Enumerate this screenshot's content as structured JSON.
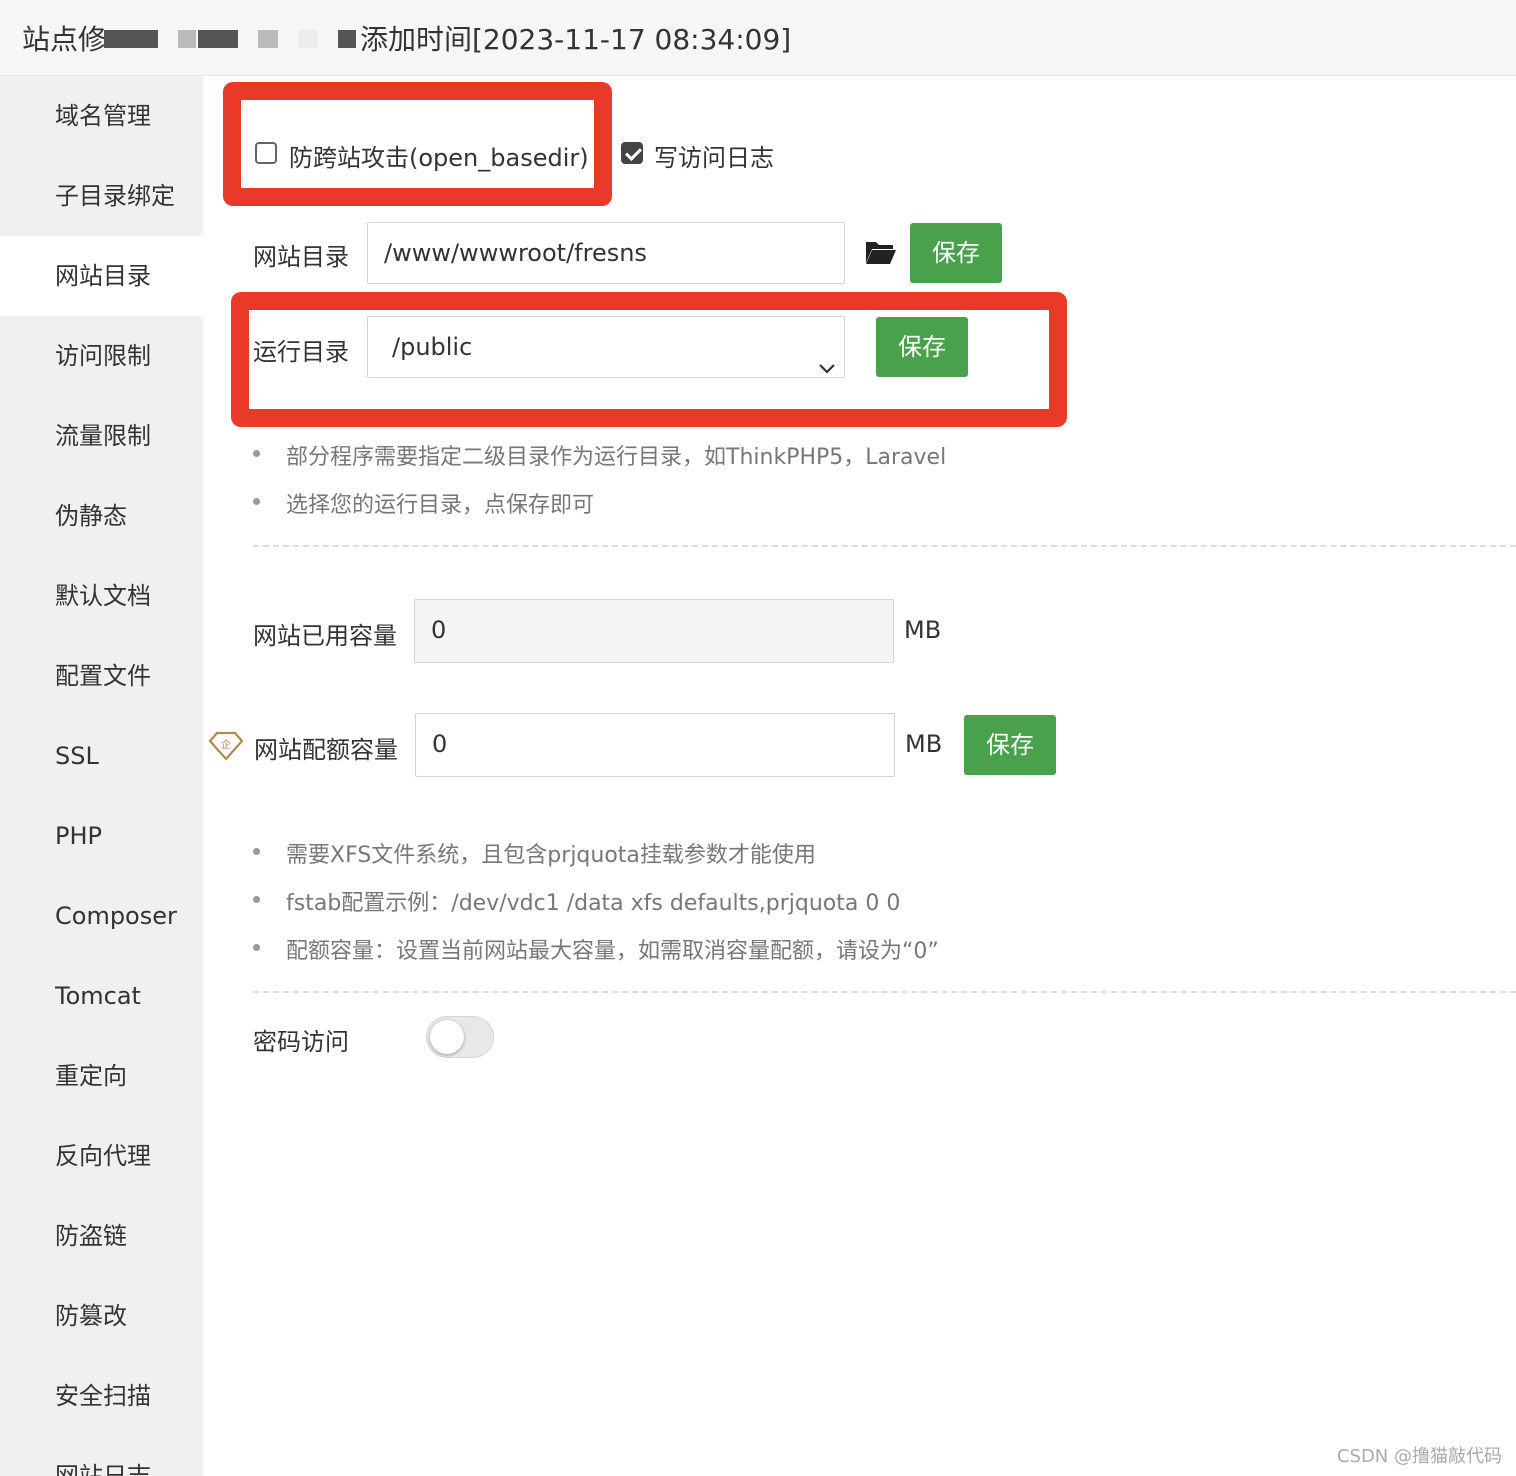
{
  "header": {
    "title_prefix": "站点修",
    "title_suffix": "添加时间[2023-11-17 08:34:09]"
  },
  "sidebar": {
    "items": [
      {
        "label": "域名管理"
      },
      {
        "label": "子目录绑定"
      },
      {
        "label": "网站目录",
        "active": true
      },
      {
        "label": "访问限制"
      },
      {
        "label": "流量限制"
      },
      {
        "label": "伪静态"
      },
      {
        "label": "默认文档"
      },
      {
        "label": "配置文件"
      },
      {
        "label": "SSL"
      },
      {
        "label": "PHP"
      },
      {
        "label": "Composer"
      },
      {
        "label": "Tomcat"
      },
      {
        "label": "重定向"
      },
      {
        "label": "反向代理"
      },
      {
        "label": "防盗链"
      },
      {
        "label": "防篡改"
      },
      {
        "label": "安全扫描"
      },
      {
        "label": "网站日志"
      }
    ]
  },
  "options": {
    "anti_xss_label": "防跨站攻击(open_basedir)",
    "anti_xss_checked": false,
    "access_log_label": "写访问日志",
    "access_log_checked": true
  },
  "site_dir": {
    "label": "网站目录",
    "value": "/www/wwwroot/fresns",
    "icon": "folder-open-icon",
    "save_label": "保存"
  },
  "run_dir": {
    "label": "运行目录",
    "selected": "/public",
    "save_label": "保存",
    "tips": [
      "部分程序需要指定二级目录作为运行目录，如ThinkPHP5，Laravel",
      "选择您的运行目录，点保存即可"
    ]
  },
  "quota": {
    "used_label": "网站已用容量",
    "used_value": "0",
    "used_unit": "MB",
    "quota_label": "网站配额容量",
    "quota_value": "0",
    "quota_unit": "MB",
    "enterprise_icon_text": "企",
    "save_label": "保存",
    "tips": [
      "需要XFS文件系统，且包含prjquota挂载参数才能使用",
      "fstab配置示例：/dev/vdc1 /data xfs defaults,prjquota 0 0",
      "配额容量：设置当前网站最大容量，如需取消容量配额，请设为“0”"
    ]
  },
  "password_access": {
    "label": "密码访问",
    "enabled": false
  },
  "watermark": "CSDN @撸猫敲代码",
  "colors": {
    "accent_green": "#4aa14c",
    "highlight_red": "#e93a29",
    "sidebar_bg": "#f0f0f0"
  }
}
